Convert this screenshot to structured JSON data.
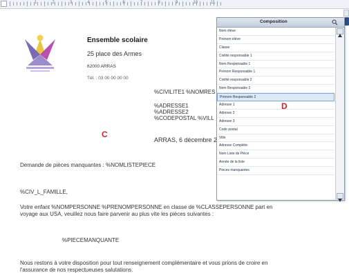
{
  "ruler": {
    "numbers": [
      "1",
      "2",
      "3",
      "4",
      "5",
      "6",
      "7",
      "8",
      "9",
      "10",
      "11"
    ]
  },
  "letterhead": {
    "organisation": "Ensemble scolaire",
    "address": "25 place des Armes",
    "city": "62000 ARRAS",
    "phone": "Tél. : 03 00 00 00 00"
  },
  "fields": {
    "civilite_nom": "%CIVILITE1 %NOMRES",
    "adresse1": "%ADRESSE1",
    "adresse2": "%ADRESSE2",
    "codepostal": "%CODEPOSTAL %VILL",
    "date_line": "ARRAS, 6 décembre 2",
    "demande": "Demande de pièces manquantes : %NOMLISTEPIECE",
    "salutation": "%CIV_L_FAMILLE,",
    "body1": "Votre enfant %NOMPERSONNE %PRENOMPERSONNE en classe de %CLASSEPERSONNE part en",
    "body2": "voyage aux USA, veuillez nous faire parvenir au plus vite les pièces suivantes :",
    "pieces": "%PIECEMANQUANTE",
    "closing1": "Nous restons à votre disposition pour tout renseignement complémentaire et vous prions de croire en",
    "closing2": "l'assurance de nos respectueuses salutations."
  },
  "markers": {
    "c": "C",
    "d": "D"
  },
  "panel": {
    "title": "Composition",
    "items": [
      "Nom élève",
      "Prénom élève",
      "Classe",
      "Civilité responsable 1",
      "Nom Responsable 1",
      "Prénom Responsable 1",
      "Civilité responsable 2",
      "Nom Responsable 2",
      "Prénom Responsable 2",
      "Adresse 1",
      "Adresse 2",
      "Adresse 3",
      "Code postal",
      "Ville",
      "Adresse Complète",
      "Nom Liste de Pièce",
      "Année de la liste",
      "Pièces manquantes"
    ],
    "selected": "Prénom Responsable 2"
  }
}
